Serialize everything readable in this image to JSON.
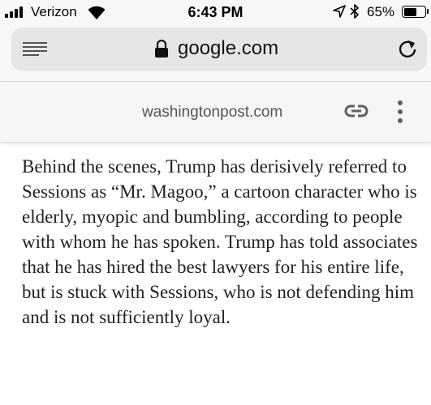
{
  "status_bar": {
    "carrier": "Verizon",
    "time": "6:43 PM",
    "battery_percent": "65%",
    "battery_level": 0.65,
    "icons": [
      "signal-icon",
      "wifi-icon",
      "location-icon",
      "bluetooth-icon",
      "battery-icon"
    ]
  },
  "browser": {
    "url": "google.com",
    "icons": [
      "menu-icon",
      "lock-icon",
      "reload-icon"
    ]
  },
  "amp_header": {
    "domain": "washingtonpost.com",
    "icons": [
      "link-icon",
      "more-icon"
    ]
  },
  "article": {
    "paragraph": "Behind the scenes, Trump has derisively referred to Sessions as “Mr. Magoo,” a cartoon character who is elderly, myopic and bumbling, according to people with whom he has spoken. Trump has told associates that he has hired the best lawyers for his entire life, but is stuck with Sessions, who is not defending him and is not sufficiently loyal."
  },
  "colors": {
    "chrome_background": "#f8f8f8",
    "omnibox_background": "#e6e6e6",
    "header_background": "#f6f6f6",
    "text": "#222222"
  }
}
